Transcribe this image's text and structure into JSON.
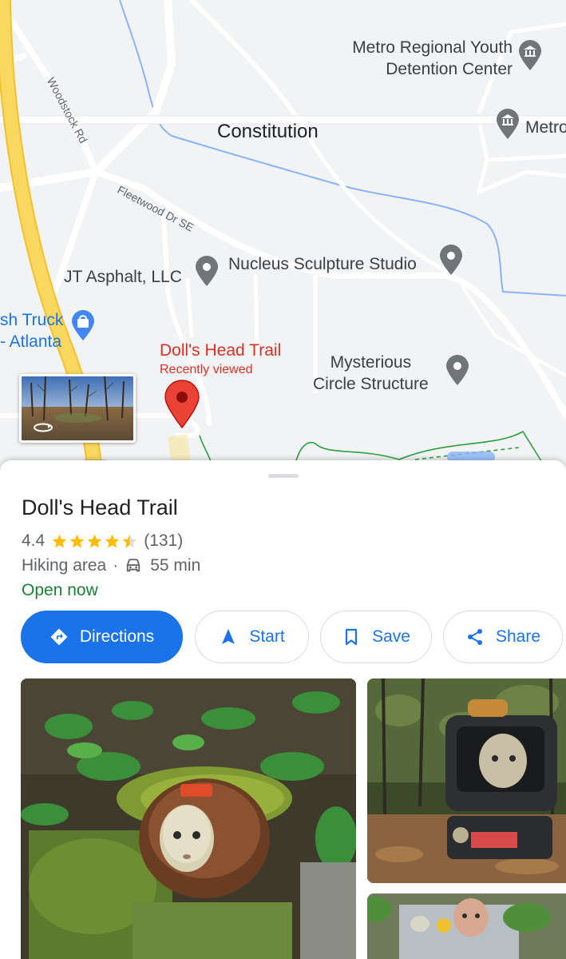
{
  "map": {
    "labels": {
      "detention_center": "Metro Regional Youth\nDetention Center",
      "metro_right": "Metro",
      "constitution": "Constitution",
      "jt_asphalt": "JT Asphalt, LLC",
      "nucleus": "Nucleus Sculpture Studio",
      "truck": "sh Truck\n- Atlanta",
      "mysterious": "Mysterious\nCircle Structure"
    },
    "road_labels": {
      "woodstock": "Woodstock Rd",
      "fleetwood": "Fleetwood Dr SE"
    },
    "selected": {
      "name": "Doll's Head Trail",
      "subtitle": "Recently viewed"
    },
    "icons": {
      "pin": "place-pin-icon",
      "museum": "museum-icon",
      "shopping": "shopping-bag-icon",
      "selected": "red-location-pin-icon",
      "street_view": "rotate-360-icon"
    }
  },
  "place": {
    "name": "Doll's Head Trail",
    "rating": "4.4",
    "stars_value": 4.4,
    "reviews": "(131)",
    "category": "Hiking area",
    "separator": "·",
    "drive_time": "55 min",
    "status": "Open now"
  },
  "actions": {
    "directions": "Directions",
    "start": "Start",
    "save": "Save",
    "share": "Share"
  },
  "colors": {
    "accent": "#1a73e8",
    "open": "#188038",
    "selected": "#d93025",
    "star": "#fbbc04",
    "map_bg": "#f1f3f4",
    "highway": "#f9d65c",
    "water": "#8ab4f8",
    "poi": "#70757a"
  }
}
